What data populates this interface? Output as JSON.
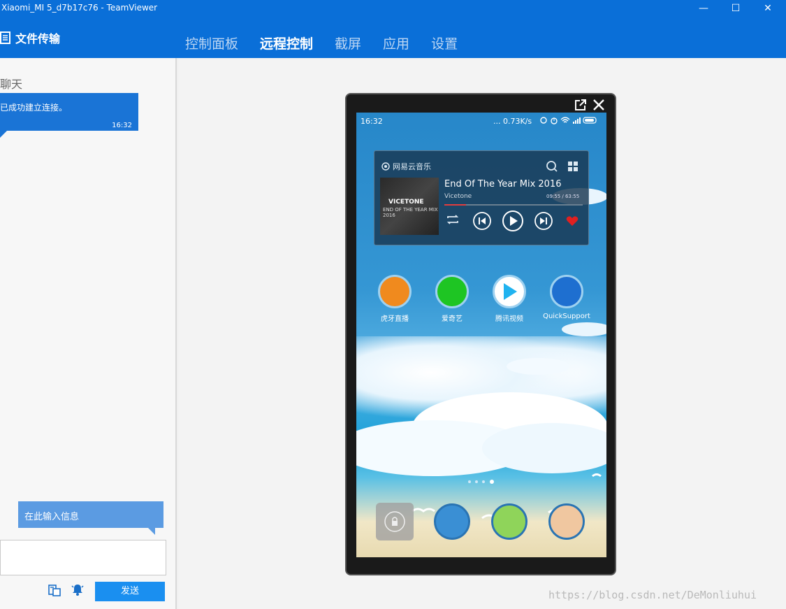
{
  "window": {
    "title": "Xiaomi_MI 5_d7b17c76 - TeamViewer",
    "buttons": {
      "minimize": "—",
      "maximize": "☐",
      "close": "✕"
    }
  },
  "header": {
    "file_transfer": "文件传输",
    "tabs": [
      {
        "label": "控制面板",
        "active": false
      },
      {
        "label": "远程控制",
        "active": true
      },
      {
        "label": "截屏",
        "active": false
      },
      {
        "label": "应用",
        "active": false
      },
      {
        "label": "设置",
        "active": false
      }
    ]
  },
  "chat": {
    "label": "聊天",
    "messages": [
      {
        "text": "已成功建立连接。",
        "time": "16:32"
      }
    ],
    "input_placeholder": "在此输入信息",
    "send_label": "发送"
  },
  "phone": {
    "status": {
      "time": "16:32",
      "speed": "... 0.73K/s"
    },
    "music_widget": {
      "brand": "网易云音乐",
      "song": "End Of The Year Mix 2016",
      "artist": "Vicetone",
      "progress_text": "09:55 / 63:55",
      "progress": 0.156,
      "album_line1": "VICETONE",
      "album_line2": "END OF THE YEAR MIX 2016"
    },
    "apps": [
      {
        "label": "虎牙直播",
        "color": "#f08a1e"
      },
      {
        "label": "爱奇艺",
        "color": "#1ec523"
      },
      {
        "label": "腾讯视频",
        "color": "#ffffff"
      },
      {
        "label": "QuickSupport",
        "color": "#1e6fd0"
      }
    ],
    "dock": [
      {
        "name": "lock-app"
      },
      {
        "name": "seagull-app"
      },
      {
        "name": "tiger-app"
      },
      {
        "name": "luffy-app"
      }
    ]
  },
  "watermark": "https://blog.csdn.net/DeMonliuhui",
  "colors": {
    "brand_blue": "#0a6fd8",
    "chat_blue": "#1a74d6",
    "send_blue": "#1a8ff0"
  }
}
